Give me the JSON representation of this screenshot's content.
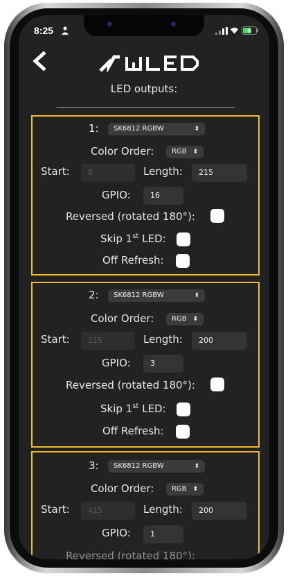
{
  "status_bar": {
    "time": "8:25"
  },
  "header": {
    "logo_text": "WLED"
  },
  "section_title": "LED outputs:",
  "labels": {
    "color_order": "Color Order:",
    "start": "Start:",
    "length": "Length:",
    "gpio": "GPIO:",
    "reversed": "Reversed (rotated 180°):",
    "skip_pre": "Skip 1",
    "skip_sup": "st",
    "skip_post": " LED:",
    "off_refresh": "Off Refresh:"
  },
  "outputs": [
    {
      "index": "1:",
      "type": "SK6812 RGBW",
      "color_order": "RGB",
      "start": "0",
      "length": "215",
      "gpio": "16"
    },
    {
      "index": "2:",
      "type": "SK6812 RGBW",
      "color_order": "RGB",
      "start": "215",
      "length": "200",
      "gpio": "3"
    },
    {
      "index": "3:",
      "type": "SK6812 RGBW",
      "color_order": "RGB",
      "start": "415",
      "length": "200",
      "gpio": "1"
    }
  ],
  "colors": {
    "accent_highlight": "#f3ba2f",
    "background": "#222222"
  }
}
